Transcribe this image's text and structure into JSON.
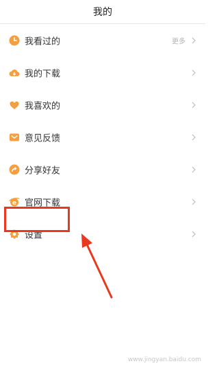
{
  "header": {
    "title": "我的"
  },
  "menu": {
    "items": [
      {
        "label": "我看过的",
        "extra": "更多",
        "icon": "clock-icon"
      },
      {
        "label": "我的下载",
        "icon": "cloud-download-icon"
      },
      {
        "label": "我喜欢的",
        "icon": "heart-icon"
      },
      {
        "label": "意见反馈",
        "icon": "envelope-icon"
      },
      {
        "label": "分享好友",
        "icon": "share-icon"
      },
      {
        "label": "官网下载",
        "icon": "browser-icon"
      },
      {
        "label": "设置",
        "icon": "gear-icon"
      }
    ]
  },
  "colors": {
    "accent": "#f5a040",
    "highlight": "#e8391e",
    "text": "#333333",
    "muted": "#b3b3b3"
  },
  "watermark": {
    "text": "www.jingyan.baidu.com"
  }
}
